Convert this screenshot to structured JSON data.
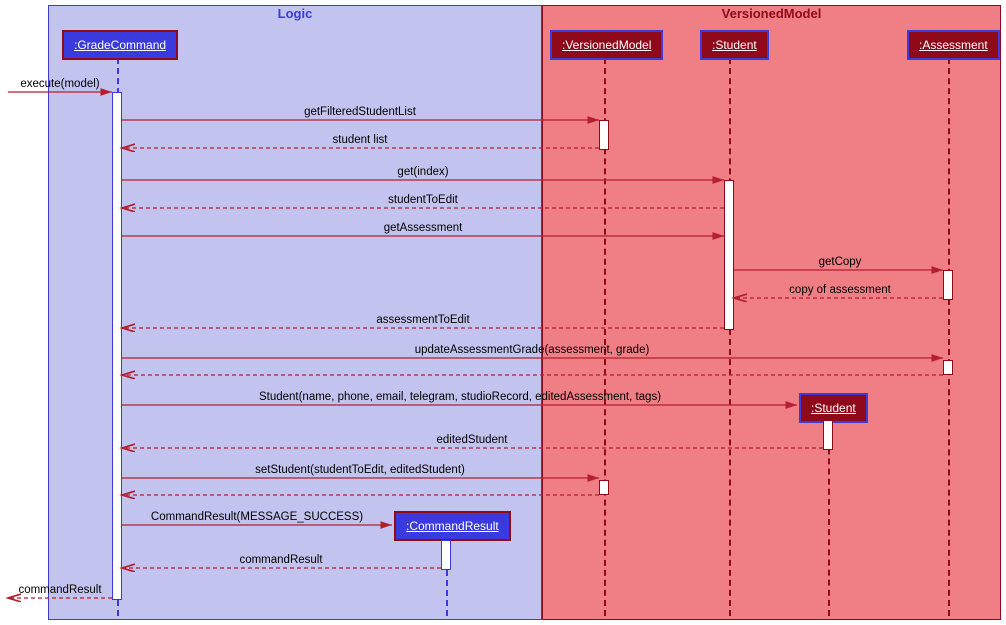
{
  "frames": {
    "logic": {
      "label": "Logic",
      "color": "#3a3adf",
      "bg": "#c3c3ef"
    },
    "vm": {
      "label": "VersionedModel",
      "color": "#8e0a1a",
      "bg": "#f07e85"
    }
  },
  "participants": {
    "gradeCommand": {
      "label": ":GradeCommand",
      "scheme": "logic"
    },
    "commandResult": {
      "label": ":CommandResult",
      "scheme": "logic"
    },
    "versionedModel": {
      "label": ":VersionedModel",
      "scheme": "vm"
    },
    "student": {
      "label": ":Student",
      "scheme": "vm"
    },
    "assessment": {
      "label": ":Assessment",
      "scheme": "vm"
    },
    "studentNew": {
      "label": ":Student",
      "scheme": "vm"
    }
  },
  "messages": {
    "execute": "execute(model)",
    "getFilteredStudentList": "getFilteredStudentList",
    "studentList": "student list",
    "getIndex": "get(index)",
    "studentToEdit": "studentToEdit",
    "getAssessment": "getAssessment",
    "getCopy": "getCopy",
    "copyOfAssessment": "copy of assessment",
    "assessmentToEdit": "assessmentToEdit",
    "updateAssessmentGrade": "updateAssessmentGrade(assessment, grade)",
    "studentCtor": "Student(name, phone, email, telegram, studioRecord, editedAssessment, tags)",
    "editedStudent": "editedStudent",
    "setStudent": "setStudent(studentToEdit, editedStudent)",
    "cmdResultCtor": "CommandResult(MESSAGE_SUCCESS)",
    "commandResultRet": "commandResult",
    "commandResultFinal": "commandResult"
  }
}
